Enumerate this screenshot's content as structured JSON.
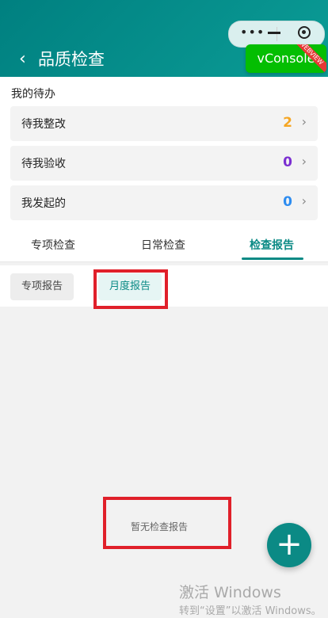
{
  "header": {
    "title": "品质检查",
    "back_icon": "chevron-left-icon",
    "capsule": {
      "more_icon": "•••",
      "minimize_icon": "minus-icon",
      "close_icon": "target-icon"
    },
    "vconsole": {
      "label": "vConsole",
      "ribbon": "WEBVIEW",
      "color": "#04be02"
    }
  },
  "todo": {
    "title": "我的待办",
    "items": [
      {
        "label": "待我整改",
        "count": "2",
        "color": "#f5a623"
      },
      {
        "label": "待我验收",
        "count": "0",
        "color": "#7b2fd1"
      },
      {
        "label": "我发起的",
        "count": "0",
        "color": "#2d8cf0"
      }
    ]
  },
  "tabs": {
    "items": [
      "专项检查",
      "日常检查",
      "检查报告"
    ],
    "active": 2
  },
  "subtabs": {
    "items": [
      "专项报告",
      "月度报告"
    ],
    "active": 1
  },
  "empty_text": "暂无检查报告",
  "fab_icon": "+",
  "watermark": {
    "line1": "激活 Windows",
    "line2": "转到“设置”以激活 Windows。"
  },
  "colors": {
    "accent": "#0b8a85",
    "header": "#008080",
    "highlight": "#e0202a"
  }
}
